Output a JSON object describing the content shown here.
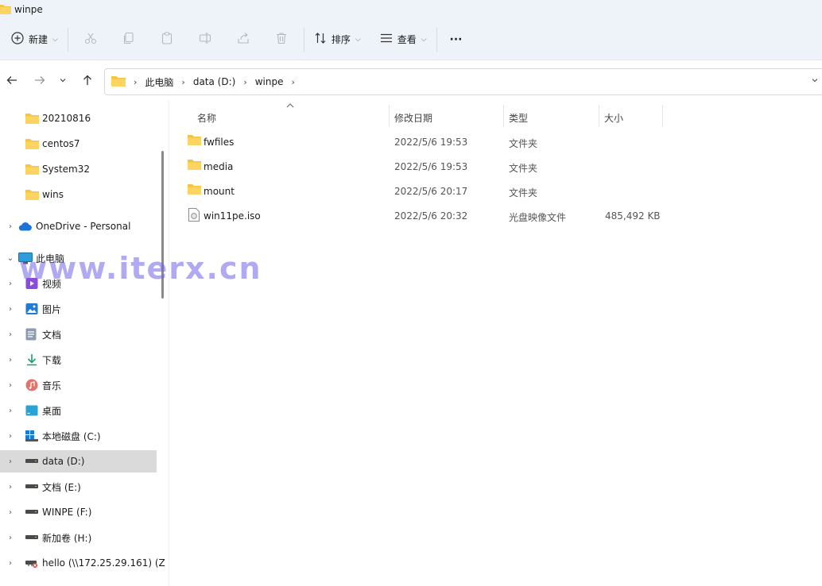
{
  "window": {
    "title": "winpe"
  },
  "toolbar": {
    "new_label": "新建",
    "sort_label": "排序",
    "view_label": "查看",
    "more_label": "···"
  },
  "address": {
    "crumbs": [
      "此电脑",
      "data (D:)",
      "winpe"
    ]
  },
  "sidebar": {
    "items": [
      {
        "label": "20210816"
      },
      {
        "label": "centos7"
      },
      {
        "label": "System32"
      },
      {
        "label": "wins"
      },
      {
        "label": "OneDrive - Personal"
      },
      {
        "label": "此电脑"
      },
      {
        "label": "视频"
      },
      {
        "label": "图片"
      },
      {
        "label": "文档"
      },
      {
        "label": "下载"
      },
      {
        "label": "音乐"
      },
      {
        "label": "桌面"
      },
      {
        "label": "本地磁盘 (C:)"
      },
      {
        "label": "data (D:)"
      },
      {
        "label": "文档 (E:)"
      },
      {
        "label": "WINPE (F:)"
      },
      {
        "label": "新加卷 (H:)"
      },
      {
        "label": "hello (\\\\172.25.29.161) (Z"
      }
    ]
  },
  "list": {
    "columns": {
      "name": "名称",
      "date": "修改日期",
      "type": "类型",
      "size": "大小"
    },
    "rows": [
      {
        "name": "fwfiles",
        "date": "2022/5/6 19:53",
        "type": "文件夹",
        "size": ""
      },
      {
        "name": "media",
        "date": "2022/5/6 19:53",
        "type": "文件夹",
        "size": ""
      },
      {
        "name": "mount",
        "date": "2022/5/6 20:17",
        "type": "文件夹",
        "size": ""
      },
      {
        "name": "win11pe.iso",
        "date": "2022/5/6 20:32",
        "type": "光盘映像文件",
        "size": "485,492 KB"
      }
    ]
  },
  "watermark": {
    "text": "www.iterx.cn"
  },
  "colors": {
    "folder": "#f6c343",
    "selected": "#dadada",
    "chrome": "#eef3fa",
    "watermark": "#6e64e6"
  }
}
